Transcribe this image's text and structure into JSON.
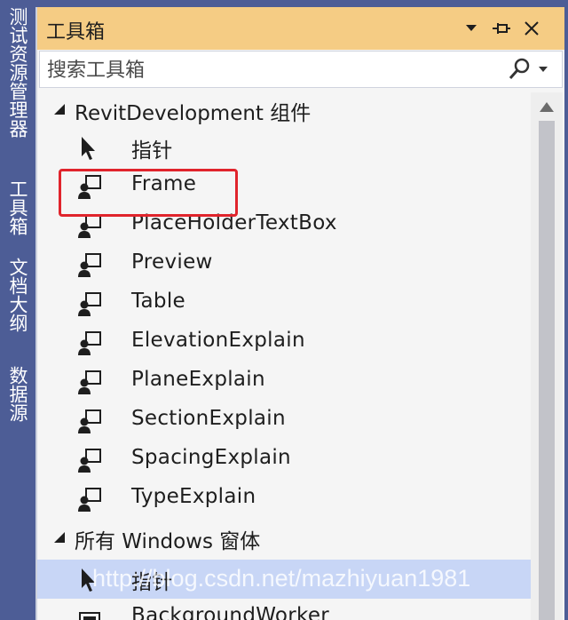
{
  "side_tabs": [
    {
      "label": "测试资源管理器"
    },
    {
      "label": "工具箱"
    },
    {
      "label": "文档大纲"
    },
    {
      "label": "数据源"
    }
  ],
  "title_bar": {
    "title": "工具箱",
    "dropdown_icon": "chevron-down-icon",
    "pin_icon": "pin-icon",
    "close_icon": "close-icon"
  },
  "search": {
    "placeholder": "搜索工具箱",
    "icon": "search-icon"
  },
  "groups": [
    {
      "label": "RevitDevelopment 组件",
      "items": [
        {
          "label": "指针",
          "icon": "pointer-icon"
        },
        {
          "label": "Frame",
          "icon": "user-control-icon"
        },
        {
          "label": "PlaceHolderTextBox",
          "icon": "user-control-icon"
        },
        {
          "label": "Preview",
          "icon": "user-control-icon"
        },
        {
          "label": "Table",
          "icon": "user-control-icon"
        },
        {
          "label": "ElevationExplain",
          "icon": "user-control-icon"
        },
        {
          "label": "PlaneExplain",
          "icon": "user-control-icon"
        },
        {
          "label": "SectionExplain",
          "icon": "user-control-icon"
        },
        {
          "label": "SpacingExplain",
          "icon": "user-control-icon"
        },
        {
          "label": "TypeExplain",
          "icon": "user-control-icon"
        }
      ]
    },
    {
      "label": "所有 Windows 窗体",
      "items": [
        {
          "label": "指针",
          "icon": "pointer-icon",
          "selected": true
        },
        {
          "label": "BackgroundWorker",
          "icon": "component-icon"
        }
      ]
    }
  ],
  "watermark": "http://blog.csdn.net/mazhiyuan1981",
  "colors": {
    "title_bar": "#f5cc84",
    "side_strip": "#4d5d96",
    "selection": "#c8d6f6",
    "highlight": "#e0242c"
  }
}
